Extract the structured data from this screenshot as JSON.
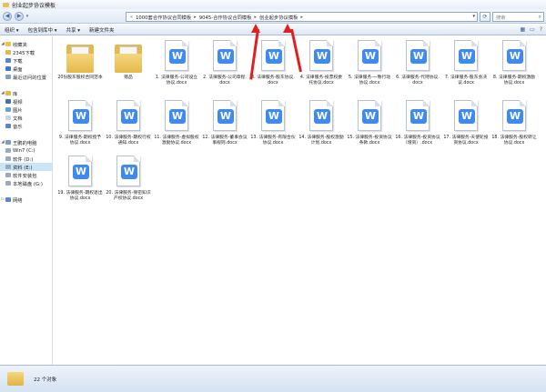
{
  "window": {
    "title": "创业起步协议模板"
  },
  "address": {
    "crumbs": [
      "1000套合作协议合同模板",
      "9045-合作协议合同模板",
      "创业起步协议模板"
    ],
    "search_placeholder": "搜索"
  },
  "toolbar": {
    "organize": "组织 ▾",
    "include": "包含到库中 ▾",
    "share": "共享 ▾",
    "new_folder": "新建文件夹"
  },
  "nav": {
    "favorites": {
      "label": "收藏夹",
      "items": [
        "2345下载",
        "下载",
        "桌面",
        "最近访问的位置"
      ]
    },
    "libraries": {
      "label": "库",
      "items": [
        "视频",
        "图片",
        "文档",
        "音乐"
      ]
    },
    "computer": {
      "label": "王鹏的电脑",
      "items": [
        "Win7 (C:)",
        "软件 (D:)",
        "资料 (E:)",
        "软件安装包",
        "本地磁盘 (G:)"
      ]
    },
    "network": {
      "label": "网络"
    }
  },
  "files": [
    {
      "type": "folder",
      "name": "20份股东股权合同范本"
    },
    {
      "type": "folder",
      "name": "赠品"
    },
    {
      "type": "doc",
      "name": "1. 法律服务-公司设立协议.docx"
    },
    {
      "type": "doc",
      "name": "2. 法律服务-公司章程.docx"
    },
    {
      "type": "doc",
      "name": "3. 法律服务-股东协议.docx"
    },
    {
      "type": "doc",
      "name": "4. 法律服务-投票权委托协议.docx"
    },
    {
      "type": "doc",
      "name": "5. 法律服务-一致行动协议.docx"
    },
    {
      "type": "doc",
      "name": "6. 法律服务-代持协议.docx"
    },
    {
      "type": "doc",
      "name": "7. 法律服务-股东会决议.docx"
    },
    {
      "type": "doc",
      "name": "8. 法律服务-期权激励协议.docx"
    },
    {
      "type": "doc",
      "name": "9. 法律服务-期权授予协议.docx"
    },
    {
      "type": "doc",
      "name": "10. 法律服务-期权行权通知.docx"
    },
    {
      "type": "doc",
      "name": "11. 法律服务-虚拟股权激励协议.docx"
    },
    {
      "type": "doc",
      "name": "12. 法律服务-董事会议事规则.docx"
    },
    {
      "type": "doc",
      "name": "13. 法律服务-有限合伙协议.docx"
    },
    {
      "type": "doc",
      "name": "14. 法律服务-股权激励计划.docx"
    },
    {
      "type": "doc",
      "name": "15. 法律服务-投资协议条款.docx"
    },
    {
      "type": "doc",
      "name": "16. 法律服务-投资协议（增资）.docx"
    },
    {
      "type": "doc",
      "name": "17. 法律服务-天使轮投资协议.docx"
    },
    {
      "type": "doc",
      "name": "18. 法律服务-股权转让协议.docx"
    },
    {
      "type": "doc",
      "name": "19. 法律服务-期权退出协议.docx"
    },
    {
      "type": "doc",
      "name": "20. 法律服务-保密知识产权协议.docx"
    }
  ],
  "status": {
    "count": "22 个对象"
  },
  "colors": {
    "wps_blue": "#3e8af0",
    "folder_yellow": "#e3b94d",
    "annotation_red": "#e02020"
  }
}
